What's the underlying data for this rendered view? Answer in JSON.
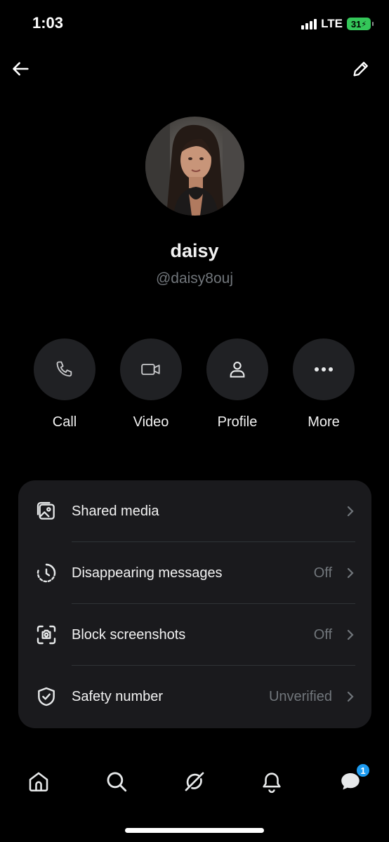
{
  "status_bar": {
    "time": "1:03",
    "network": "LTE",
    "battery": "31"
  },
  "top_nav": {
    "back_icon": "arrow-left-icon",
    "edit_icon": "pencil-icon"
  },
  "profile": {
    "name": "daisy",
    "handle": "@daisy8ouj",
    "avatar_icon": "avatar-photo"
  },
  "actions": [
    {
      "label": "Call",
      "icon": "phone-icon"
    },
    {
      "label": "Video",
      "icon": "video-camera-icon"
    },
    {
      "label": "Profile",
      "icon": "person-icon"
    },
    {
      "label": "More",
      "icon": "ellipsis-icon"
    }
  ],
  "settings": [
    {
      "label": "Shared media",
      "value": "",
      "icon": "shared-media-icon"
    },
    {
      "label": "Disappearing messages",
      "value": "Off",
      "icon": "timer-icon"
    },
    {
      "label": "Block screenshots",
      "value": "Off",
      "icon": "screenshot-camera-icon"
    },
    {
      "label": "Safety number",
      "value": "Unverified",
      "icon": "shield-check-icon"
    }
  ],
  "bottom_nav": {
    "items": [
      "home-icon",
      "search-icon",
      "grok-icon",
      "notifications-icon",
      "messages-icon"
    ],
    "messages_badge": "1"
  },
  "colors": {
    "background": "#000000",
    "card": "#1a1a1d",
    "action_circle": "#202124",
    "muted_text": "#71767b",
    "badge": "#1d9bf0",
    "battery": "#34c759"
  }
}
